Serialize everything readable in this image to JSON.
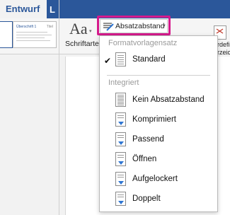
{
  "ribbon": {
    "tabs": [
      {
        "label": "Entwurf"
      },
      {
        "label": "L"
      }
    ],
    "schriftarten": {
      "glyph": "Aa",
      "label": "Schriftarten"
    },
    "absatzabstand_button": {
      "label": "Absatzabstand"
    },
    "right_fragment": {
      "label_line1": "erdefi",
      "label_line2": "erzeic"
    }
  },
  "thumbnail": {
    "heading": "Überschrift 1",
    "title": "Titel"
  },
  "menu": {
    "section_style_set": "Formatvorlagensatz",
    "standard": {
      "label": "Standard",
      "checked": true
    },
    "section_builtin": "Integriert",
    "items": [
      {
        "label": "Kein Absatzabstand"
      },
      {
        "label": "Komprimiert"
      },
      {
        "label": "Passend"
      },
      {
        "label": "Öffnen"
      },
      {
        "label": "Aufgelockert"
      },
      {
        "label": "Doppelt"
      }
    ]
  },
  "colors": {
    "accent": "#2b579a",
    "highlight": "#d61a8c",
    "arrow": "#2e75d1"
  }
}
